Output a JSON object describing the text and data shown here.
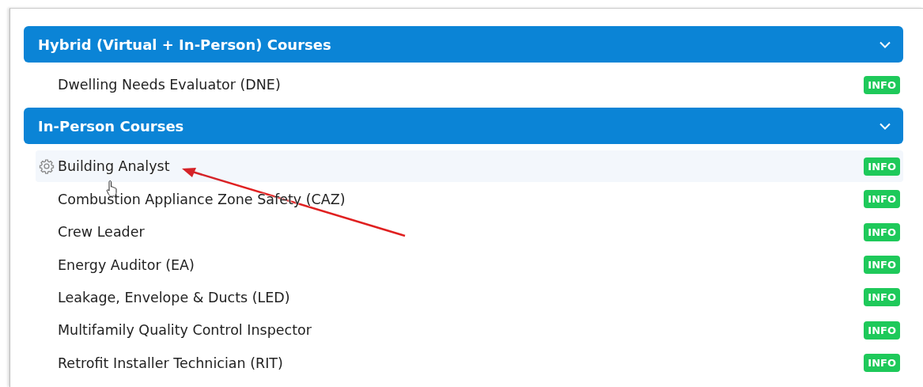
{
  "sections": [
    {
      "title": "Hybrid (Virtual + In-Person) Courses",
      "expanded": true,
      "courses": [
        {
          "name": "Dwelling Needs Evaluator (DNE)",
          "badge": "INFO",
          "hovered": false
        }
      ]
    },
    {
      "title": "In-Person Courses",
      "expanded": true,
      "courses": [
        {
          "name": "Building Analyst",
          "badge": "INFO",
          "hovered": true
        },
        {
          "name": "Combustion Appliance Zone Safety (CAZ)",
          "badge": "INFO",
          "hovered": false
        },
        {
          "name": "Crew Leader",
          "badge": "INFO",
          "hovered": false
        },
        {
          "name": "Energy Auditor (EA)",
          "badge": "INFO",
          "hovered": false
        },
        {
          "name": "Leakage, Envelope & Ducts (LED)",
          "badge": "INFO",
          "hovered": false
        },
        {
          "name": "Multifamily Quality Control Inspector",
          "badge": "INFO",
          "hovered": false
        },
        {
          "name": "Retrofit Installer Technician (RIT)",
          "badge": "INFO",
          "hovered": false
        }
      ]
    }
  ]
}
